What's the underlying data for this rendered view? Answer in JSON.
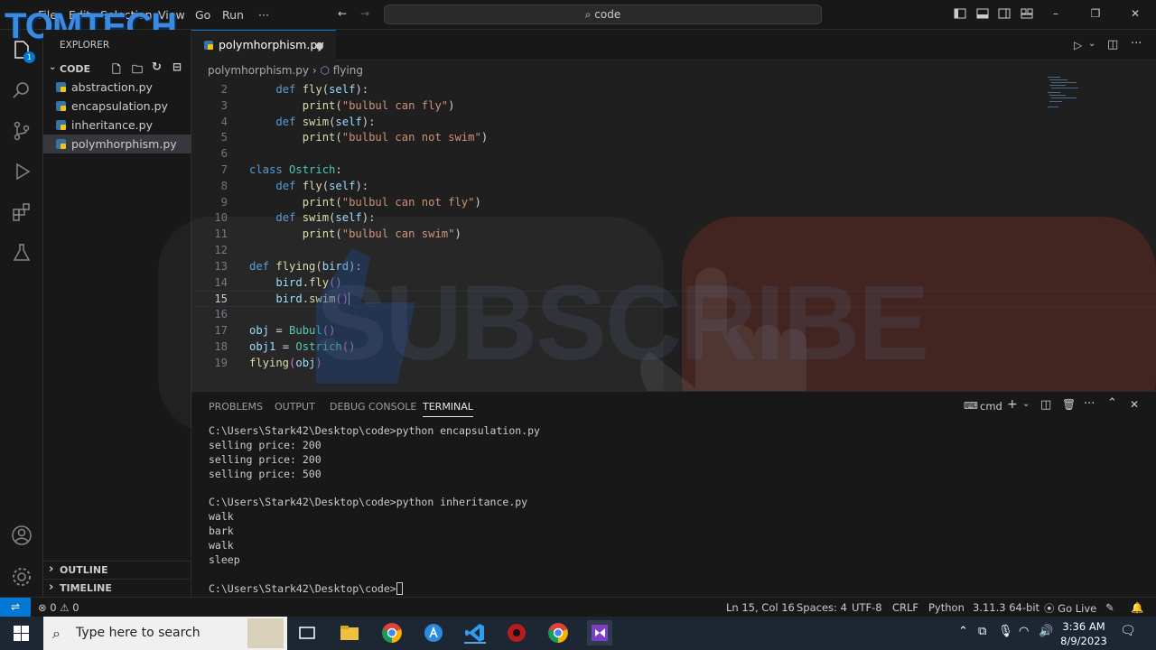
{
  "titlebar": {
    "logo": "TOMTECH",
    "menu": [
      "File",
      "Edit",
      "Selection",
      "View",
      "Go",
      "Run",
      "···"
    ],
    "search": "code"
  },
  "sidebar": {
    "title": "EXPLORER",
    "folder": "CODE",
    "files": [
      "abstraction.py",
      "encapsulation.py",
      "inheritance.py",
      "polymhorphism.py"
    ],
    "outline": "OUTLINE",
    "timeline": "TIMELINE",
    "badge": "1"
  },
  "editor": {
    "tab": "polymhorphism.py",
    "breadcrumb_file": "polymhorphism.py",
    "breadcrumb_symbol": "flying",
    "current_line": 15
  },
  "panel": {
    "tabs": [
      "PROBLEMS",
      "OUTPUT",
      "DEBUG CONSOLE",
      "TERMINAL"
    ],
    "shell": "cmd",
    "lines": [
      "C:\\Users\\Stark42\\Desktop\\code>python encapsulation.py",
      "selling price: 200",
      "selling price: 200",
      "selling price: 500",
      "",
      "C:\\Users\\Stark42\\Desktop\\code>python inheritance.py",
      "walk",
      "bark",
      "walk",
      "sleep",
      "",
      "C:\\Users\\Stark42\\Desktop\\code>"
    ]
  },
  "status": {
    "problems": "0",
    "warnings": "0",
    "position": "Ln 15, Col 16",
    "spaces": "Spaces: 4",
    "encoding": "UTF-8",
    "eol": "CRLF",
    "language": "Python",
    "interpreter": "3.11.3 64-bit",
    "golive": "Go Live"
  },
  "taskbar": {
    "search_placeholder": "Type here to search",
    "time": "3:36 AM",
    "date": "8/9/2023"
  },
  "overlay": {
    "watermark": "SUBSCRIBE"
  },
  "colors": {
    "accent": "#0078d4",
    "keyword": "#569cd6",
    "class": "#4ec9b0",
    "function": "#dcdcaa",
    "string": "#ce9178"
  }
}
